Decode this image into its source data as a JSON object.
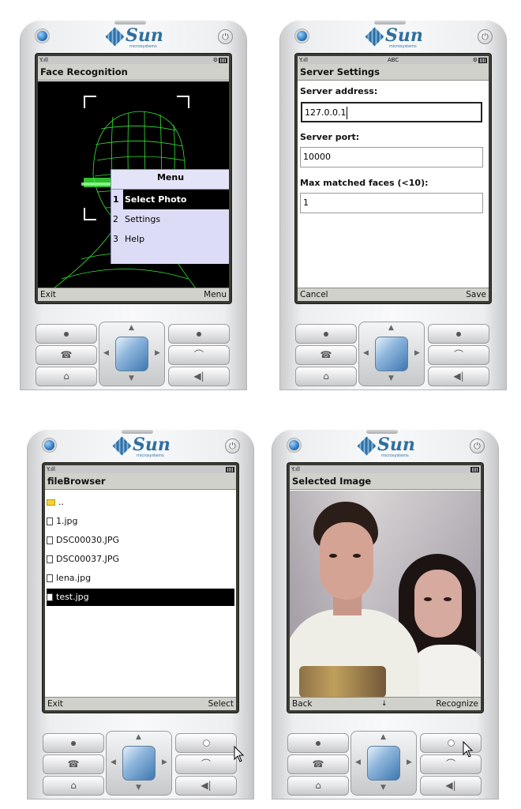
{
  "brand": {
    "logo_text": "Sun",
    "logo_sub": "microsystems"
  },
  "icons": {
    "power": "⏻",
    "signal": "Y.ıll",
    "gear": "⚙",
    "call": "☎",
    "end_call": "⌒",
    "home": "⌂",
    "back": "◀|"
  },
  "phone1": {
    "title": "Face Recognition",
    "menu": {
      "title": "Menu",
      "items": [
        {
          "num": "1",
          "label": "Select Photo",
          "selected": true
        },
        {
          "num": "2",
          "label": "Settings",
          "selected": false
        },
        {
          "num": "3",
          "label": "Help",
          "selected": false
        }
      ]
    },
    "soft_left": "Exit",
    "soft_right": "Menu"
  },
  "phone2": {
    "title": "Server Settings",
    "input_mode": "ABC",
    "fields": [
      {
        "label": "Server address:",
        "value": "127.0.0.1"
      },
      {
        "label": "Server port:",
        "value": "10000"
      },
      {
        "label": "Max matched faces (<10):",
        "value": "1"
      }
    ],
    "soft_left": "Cancel",
    "soft_right": "Save"
  },
  "phone3": {
    "title": "fileBrowser",
    "files": [
      {
        "name": "..",
        "type": "folder",
        "selected": false
      },
      {
        "name": "1.jpg",
        "type": "file",
        "selected": false
      },
      {
        "name": "DSC00030.JPG",
        "type": "file",
        "selected": false
      },
      {
        "name": "DSC00037.JPG",
        "type": "file",
        "selected": false
      },
      {
        "name": "lena.jpg",
        "type": "file",
        "selected": false
      },
      {
        "name": "test.jpg",
        "type": "file",
        "selected": true
      }
    ],
    "soft_left": "Exit",
    "soft_right": "Select"
  },
  "phone4": {
    "title": "Selected Image",
    "soft_left": "Back",
    "soft_right": "Recognize",
    "scroll_indicator": "↓"
  },
  "colors": {
    "title_bar": "#d1d1cb",
    "menu_bg": "#dcdcf6",
    "wireframe": "#3cff3c",
    "selection": "#000000"
  }
}
